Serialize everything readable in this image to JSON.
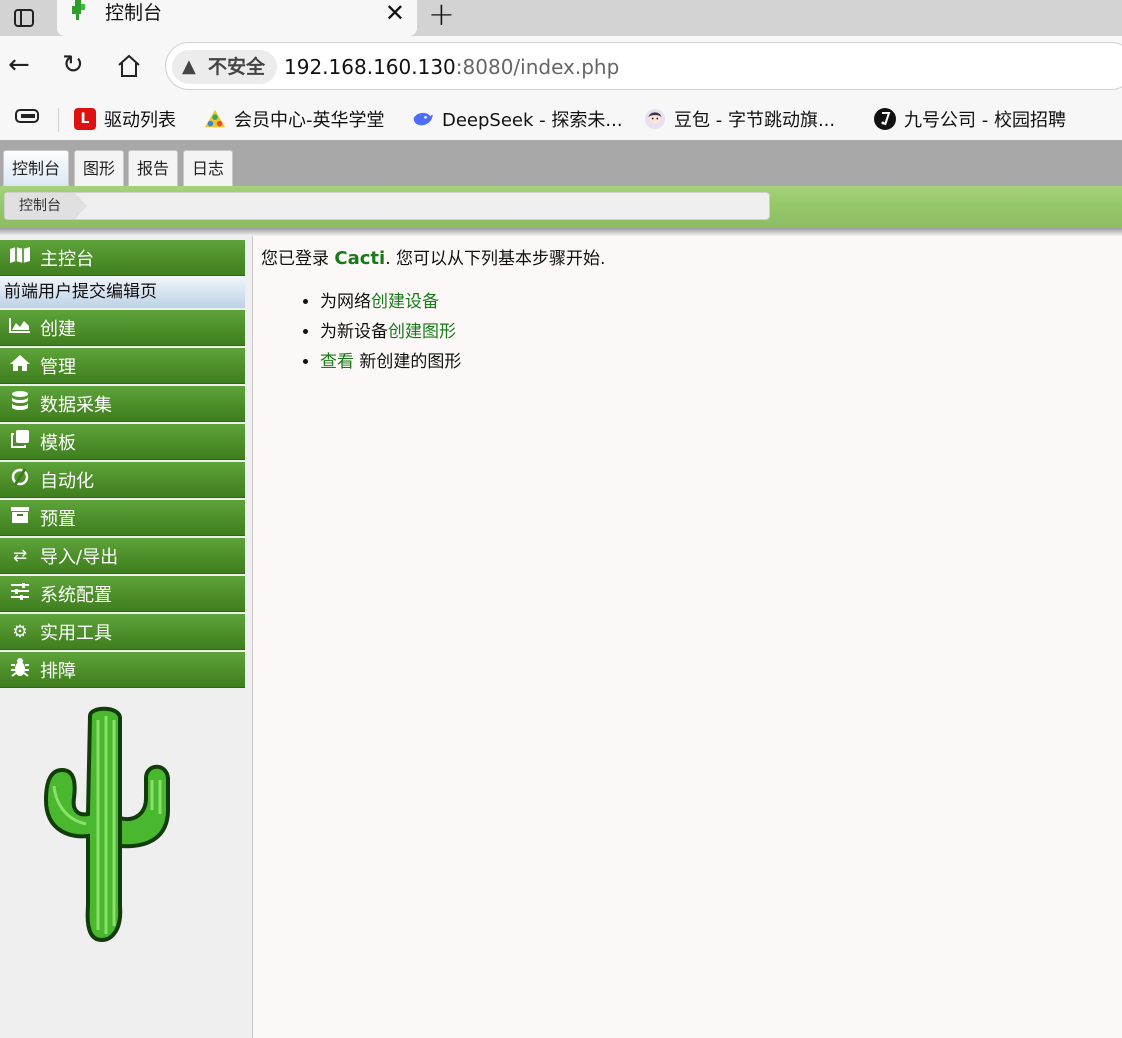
{
  "browser": {
    "tab_title": "控制台",
    "insecure_label": "不安全",
    "url_host": "192.168.160.130",
    "url_rest": ":8080/index.php"
  },
  "bookmarks": [
    {
      "label": "驱动列表",
      "icon": "L"
    },
    {
      "label": "会员中心-英华学堂",
      "icon": "yinghua"
    },
    {
      "label": "DeepSeek - 探索未...",
      "icon": "deepseek"
    },
    {
      "label": "豆包 - 字节跳动旗...",
      "icon": "doubao"
    },
    {
      "label": "九号公司 - 校园招聘",
      "icon": "ninebot"
    }
  ],
  "top_tabs": [
    "控制台",
    "图形",
    "报告",
    "日志"
  ],
  "breadcrumb": "控制台",
  "sidebar": {
    "main_console": "主控台",
    "submenu": "前端用户提交编辑页",
    "items": [
      "创建",
      "管理",
      "数据采集",
      "模板",
      "自动化",
      "预置",
      "导入/导出",
      "系统配置",
      "实用工具",
      "排障"
    ]
  },
  "main": {
    "welcome_prefix": "您已登录 ",
    "brand": "Cacti",
    "welcome_suffix": ". 您可以从下列基本步骤开始.",
    "step1_prefix": "为网络",
    "step1_link": "创建设备",
    "step2_prefix": "为新设备",
    "step2_link": "创建图形",
    "step3_link": "查看",
    "step3_suffix": " 新创建的图形"
  },
  "colors": {
    "menu_green": "#4f9130",
    "band_green": "#9ccc70",
    "link_green": "#1a7a1a"
  }
}
